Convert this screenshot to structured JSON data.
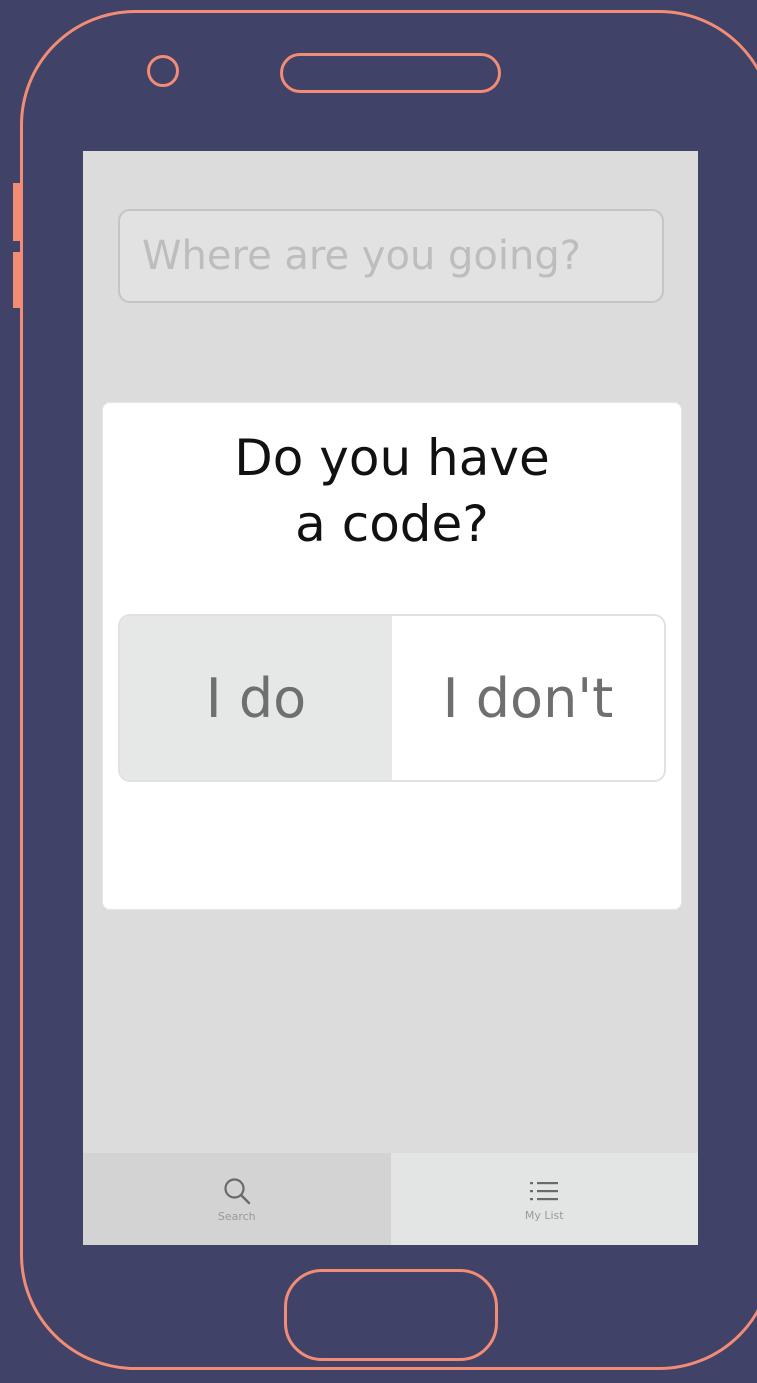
{
  "search": {
    "placeholder": "Where are you going?",
    "value": ""
  },
  "dialog": {
    "title_line1": "Do you have",
    "title_line2": "a code?",
    "options": [
      {
        "label": "I do",
        "selected": true
      },
      {
        "label": "I don't",
        "selected": false
      }
    ]
  },
  "tabs": [
    {
      "label": "Search",
      "icon": "search-icon",
      "active": true
    },
    {
      "label": "My List",
      "icon": "list-icon",
      "active": false
    }
  ],
  "colors": {
    "background": "#404268",
    "frame": "#f28c74",
    "screen": "#dcdcdc"
  }
}
